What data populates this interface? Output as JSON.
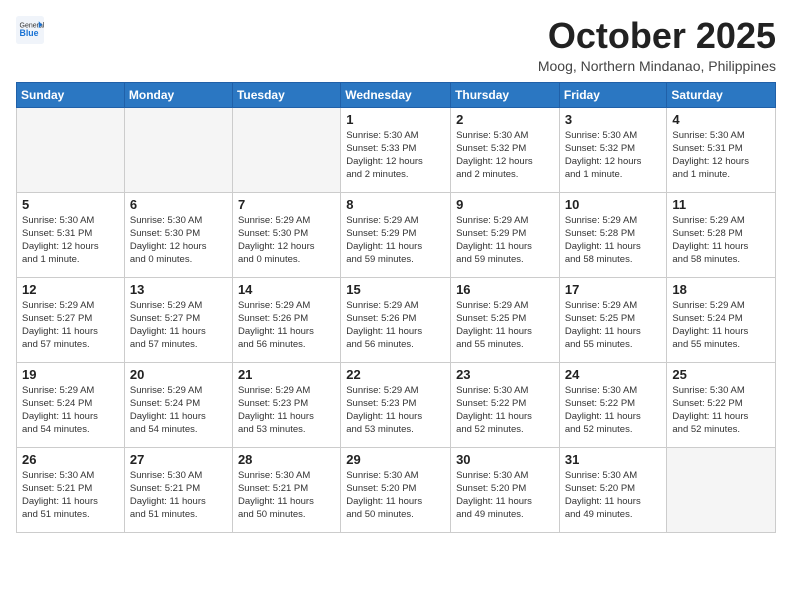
{
  "header": {
    "logo_general": "General",
    "logo_blue": "Blue",
    "month_title": "October 2025",
    "location": "Moog, Northern Mindanao, Philippines"
  },
  "weekdays": [
    "Sunday",
    "Monday",
    "Tuesday",
    "Wednesday",
    "Thursday",
    "Friday",
    "Saturday"
  ],
  "weeks": [
    [
      {
        "day": "",
        "info": ""
      },
      {
        "day": "",
        "info": ""
      },
      {
        "day": "",
        "info": ""
      },
      {
        "day": "1",
        "info": "Sunrise: 5:30 AM\nSunset: 5:33 PM\nDaylight: 12 hours\nand 2 minutes."
      },
      {
        "day": "2",
        "info": "Sunrise: 5:30 AM\nSunset: 5:32 PM\nDaylight: 12 hours\nand 2 minutes."
      },
      {
        "day": "3",
        "info": "Sunrise: 5:30 AM\nSunset: 5:32 PM\nDaylight: 12 hours\nand 1 minute."
      },
      {
        "day": "4",
        "info": "Sunrise: 5:30 AM\nSunset: 5:31 PM\nDaylight: 12 hours\nand 1 minute."
      }
    ],
    [
      {
        "day": "5",
        "info": "Sunrise: 5:30 AM\nSunset: 5:31 PM\nDaylight: 12 hours\nand 1 minute."
      },
      {
        "day": "6",
        "info": "Sunrise: 5:30 AM\nSunset: 5:30 PM\nDaylight: 12 hours\nand 0 minutes."
      },
      {
        "day": "7",
        "info": "Sunrise: 5:29 AM\nSunset: 5:30 PM\nDaylight: 12 hours\nand 0 minutes."
      },
      {
        "day": "8",
        "info": "Sunrise: 5:29 AM\nSunset: 5:29 PM\nDaylight: 11 hours\nand 59 minutes."
      },
      {
        "day": "9",
        "info": "Sunrise: 5:29 AM\nSunset: 5:29 PM\nDaylight: 11 hours\nand 59 minutes."
      },
      {
        "day": "10",
        "info": "Sunrise: 5:29 AM\nSunset: 5:28 PM\nDaylight: 11 hours\nand 58 minutes."
      },
      {
        "day": "11",
        "info": "Sunrise: 5:29 AM\nSunset: 5:28 PM\nDaylight: 11 hours\nand 58 minutes."
      }
    ],
    [
      {
        "day": "12",
        "info": "Sunrise: 5:29 AM\nSunset: 5:27 PM\nDaylight: 11 hours\nand 57 minutes."
      },
      {
        "day": "13",
        "info": "Sunrise: 5:29 AM\nSunset: 5:27 PM\nDaylight: 11 hours\nand 57 minutes."
      },
      {
        "day": "14",
        "info": "Sunrise: 5:29 AM\nSunset: 5:26 PM\nDaylight: 11 hours\nand 56 minutes."
      },
      {
        "day": "15",
        "info": "Sunrise: 5:29 AM\nSunset: 5:26 PM\nDaylight: 11 hours\nand 56 minutes."
      },
      {
        "day": "16",
        "info": "Sunrise: 5:29 AM\nSunset: 5:25 PM\nDaylight: 11 hours\nand 55 minutes."
      },
      {
        "day": "17",
        "info": "Sunrise: 5:29 AM\nSunset: 5:25 PM\nDaylight: 11 hours\nand 55 minutes."
      },
      {
        "day": "18",
        "info": "Sunrise: 5:29 AM\nSunset: 5:24 PM\nDaylight: 11 hours\nand 55 minutes."
      }
    ],
    [
      {
        "day": "19",
        "info": "Sunrise: 5:29 AM\nSunset: 5:24 PM\nDaylight: 11 hours\nand 54 minutes."
      },
      {
        "day": "20",
        "info": "Sunrise: 5:29 AM\nSunset: 5:24 PM\nDaylight: 11 hours\nand 54 minutes."
      },
      {
        "day": "21",
        "info": "Sunrise: 5:29 AM\nSunset: 5:23 PM\nDaylight: 11 hours\nand 53 minutes."
      },
      {
        "day": "22",
        "info": "Sunrise: 5:29 AM\nSunset: 5:23 PM\nDaylight: 11 hours\nand 53 minutes."
      },
      {
        "day": "23",
        "info": "Sunrise: 5:30 AM\nSunset: 5:22 PM\nDaylight: 11 hours\nand 52 minutes."
      },
      {
        "day": "24",
        "info": "Sunrise: 5:30 AM\nSunset: 5:22 PM\nDaylight: 11 hours\nand 52 minutes."
      },
      {
        "day": "25",
        "info": "Sunrise: 5:30 AM\nSunset: 5:22 PM\nDaylight: 11 hours\nand 52 minutes."
      }
    ],
    [
      {
        "day": "26",
        "info": "Sunrise: 5:30 AM\nSunset: 5:21 PM\nDaylight: 11 hours\nand 51 minutes."
      },
      {
        "day": "27",
        "info": "Sunrise: 5:30 AM\nSunset: 5:21 PM\nDaylight: 11 hours\nand 51 minutes."
      },
      {
        "day": "28",
        "info": "Sunrise: 5:30 AM\nSunset: 5:21 PM\nDaylight: 11 hours\nand 50 minutes."
      },
      {
        "day": "29",
        "info": "Sunrise: 5:30 AM\nSunset: 5:20 PM\nDaylight: 11 hours\nand 50 minutes."
      },
      {
        "day": "30",
        "info": "Sunrise: 5:30 AM\nSunset: 5:20 PM\nDaylight: 11 hours\nand 49 minutes."
      },
      {
        "day": "31",
        "info": "Sunrise: 5:30 AM\nSunset: 5:20 PM\nDaylight: 11 hours\nand 49 minutes."
      },
      {
        "day": "",
        "info": ""
      }
    ]
  ]
}
